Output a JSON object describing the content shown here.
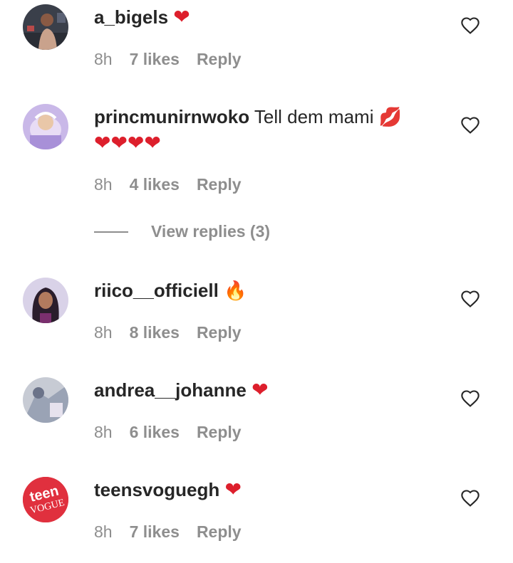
{
  "comments": [
    {
      "username": "a_bigels",
      "text": "",
      "emoji": "❤",
      "time": "8h",
      "likes": "7 likes",
      "reply": "Reply"
    },
    {
      "username": "princmunirnwoko",
      "text": "Tell dem mami",
      "emoji": "💋",
      "emoji_line2": "❤❤❤❤",
      "time": "8h",
      "likes": "4 likes",
      "reply": "Reply",
      "view_replies": "View replies (3)"
    },
    {
      "username": "riico__officiell",
      "text": "",
      "emoji": "🔥",
      "time": "8h",
      "likes": "8 likes",
      "reply": "Reply"
    },
    {
      "username": "andrea__johanne",
      "text": "",
      "emoji": "❤",
      "time": "8h",
      "likes": "6 likes",
      "reply": "Reply"
    },
    {
      "username": "teensvoguegh",
      "text": "",
      "emoji": "❤",
      "time": "8h",
      "likes": "7 likes",
      "reply": "Reply",
      "avatar_logo_text": "teen VOGUE"
    }
  ],
  "icons": {
    "like": "heart-outline-icon"
  },
  "colors": {
    "text": "#262626",
    "meta": "#8e8e8e",
    "heart": "#dd1f2c",
    "teen_vogue_brand": "#e0303e"
  }
}
